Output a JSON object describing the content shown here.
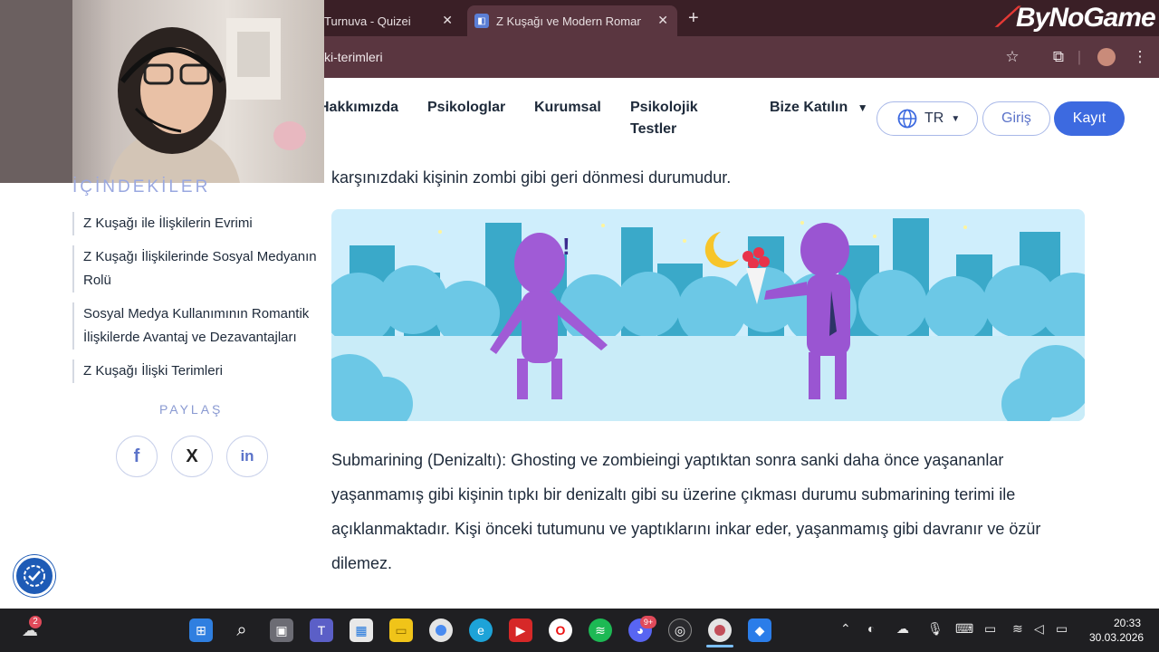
{
  "browser": {
    "tabs": [
      {
        "title": "Turnuva - Quizei"
      },
      {
        "title": "Z Kuşağı ve Modern Romantik İ"
      }
    ],
    "tab_close": "✕",
    "new_tab": "+",
    "url": "ki-terimleri",
    "brand": "ByNoGame"
  },
  "site_nav": {
    "links": [
      "Hakkımızda",
      "Psikologlar",
      "Kurumsal",
      "Psikolojik",
      "Testler",
      "Bize Katılın"
    ],
    "lang": "TR",
    "login": "Giriş",
    "signup": "Kayıt"
  },
  "sidebar": {
    "toc_title": "İÇİNDEKİLER",
    "toc_items": [
      "Z Kuşağı ile İlişkilerin Evrimi",
      "Z Kuşağı İlişkilerinde Sosyal Medyanın Rolü",
      "Sosyal Medya Kullanımının Romantik İlişkilerde Avantaj ve Dezavantajları",
      "Z Kuşağı İlişki Terimleri"
    ],
    "share_title": "PAYLAŞ",
    "share": [
      "f",
      "X",
      "in"
    ]
  },
  "article": {
    "line_top": "karşınızdaki kişinin zombi gibi geri dönmesi durumudur.",
    "para_submarining": "Submarining (Denizaltı): Ghosting ve zombieingi yaptıktan sonra sanki daha önce yaşananlar yaşanmamış gibi kişinin tıpkı bir denizaltı gibi su üzerine çıkması durumu submarining terimi ile açıklanmaktadır. Kişi önceki tutumunu ve yaptıklarını inkar eder, yaşanmamış gibi davranır ve özür dilemez."
  },
  "taskbar": {
    "weather_badge": "2",
    "discord_badge": "9+",
    "time": "20:33",
    "date": "30.03.2026"
  },
  "colors": {
    "tab_bg": "#3a1f26",
    "addr_bg": "#5a3640",
    "accent": "#3d6ae0",
    "sky": "#cfeefc",
    "city": "#3aa9c9",
    "figure": "#a05bd6"
  }
}
